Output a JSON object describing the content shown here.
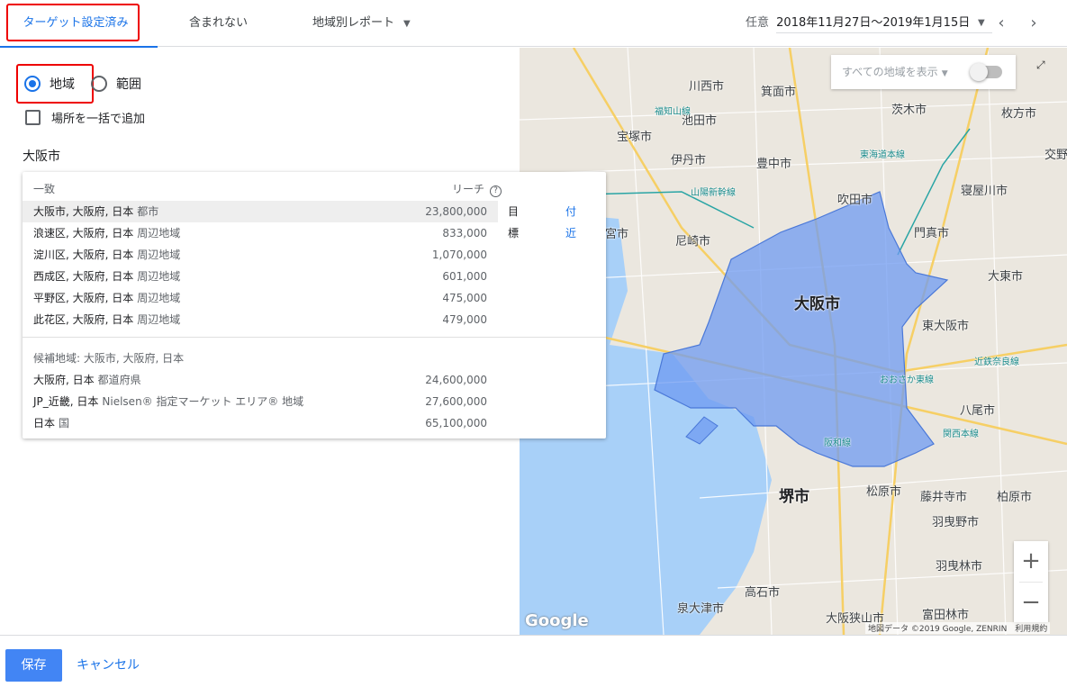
{
  "tabs": {
    "targeted": "ターゲット設定済み",
    "excluded": "含まれない",
    "report": "地域別レポート"
  },
  "date": {
    "label": "任意",
    "value": "2018年11月27日～2019年1月15日"
  },
  "left": {
    "radio_location": "地域",
    "radio_radius": "範囲",
    "bulk_add": "場所を一括で追加",
    "search_value": "大阪市"
  },
  "dropdown": {
    "match_header": "一致",
    "reach_header": "リーチ",
    "rows": [
      {
        "name": "大阪市, 大阪府, 日本",
        "type": "都市",
        "reach": "23,800,000"
      },
      {
        "name": "浪速区, 大阪府, 日本",
        "type": "周辺地域",
        "reach": "833,000"
      },
      {
        "name": "淀川区, 大阪府, 日本",
        "type": "周辺地域",
        "reach": "1,070,000"
      },
      {
        "name": "西成区, 大阪府, 日本",
        "type": "周辺地域",
        "reach": "601,000"
      },
      {
        "name": "平野区, 大阪府, 日本",
        "type": "周辺地域",
        "reach": "475,000"
      },
      {
        "name": "此花区, 大阪府, 日本",
        "type": "周辺地域",
        "reach": "479,000"
      }
    ],
    "action_target": "目標",
    "action_nearby": "付近",
    "suggest_header": "候補地域: 大阪市, 大阪府, 日本",
    "suggest_rows": [
      {
        "name": "大阪府, 日本",
        "type": "都道府県",
        "reach": "24,600,000"
      },
      {
        "name": "JP_近畿, 日本",
        "type": "Nielsen® 指定マーケット エリア® 地域",
        "reach": "27,600,000"
      },
      {
        "name": "日本",
        "type": "国",
        "reach": "65,100,000"
      }
    ]
  },
  "map": {
    "show_all": "すべての地域を表示",
    "labels": {
      "osaka": "大阪市",
      "sakai": "堺市",
      "kawanishi": "川西市",
      "minoh": "箕面市",
      "ibaraki": "茨木市",
      "hirakata": "枚方市",
      "ikeda": "池田市",
      "takarazuka": "宝塚市",
      "itami": "伊丹市",
      "toyonaka": "豊中市",
      "suita": "吹田市",
      "neyagawa": "寝屋川市",
      "katano": "交野",
      "nishinomiya": "宮市",
      "amagasaki": "尼崎市",
      "moriguchi": "門真市",
      "daito": "大東市",
      "higashiosaka": "東大阪市",
      "yao": "八尾市",
      "matsubara": "松原市",
      "fujiidera": "藤井寺市",
      "kashiwara": "柏原市",
      "habikino": "羽曳野市",
      "tondabayashi": "富田林市",
      "takaishi": "高石市",
      "izumiotsu": "泉大津市",
      "osakasayama": "大阪狭山市",
      "haibara": "羽曳林市"
    },
    "rail_labels": {
      "sanyo": "山陽新幹線",
      "tokaido": "東海道本線",
      "kintetsu": "近鉄奈良線",
      "kansai": "関西本線",
      "hanwa": "阪和線",
      "osakahigashi": "おおさか東線",
      "fukuchiyama": "福知山線"
    },
    "google": "Google",
    "attribution": "地図データ ©2019 Google, ZENRIN　利用規約",
    "zoom_in": "+",
    "zoom_out": "−",
    "polygon_color": "#6f9bf2"
  },
  "footer": {
    "save": "保存",
    "cancel": "キャンセル"
  }
}
